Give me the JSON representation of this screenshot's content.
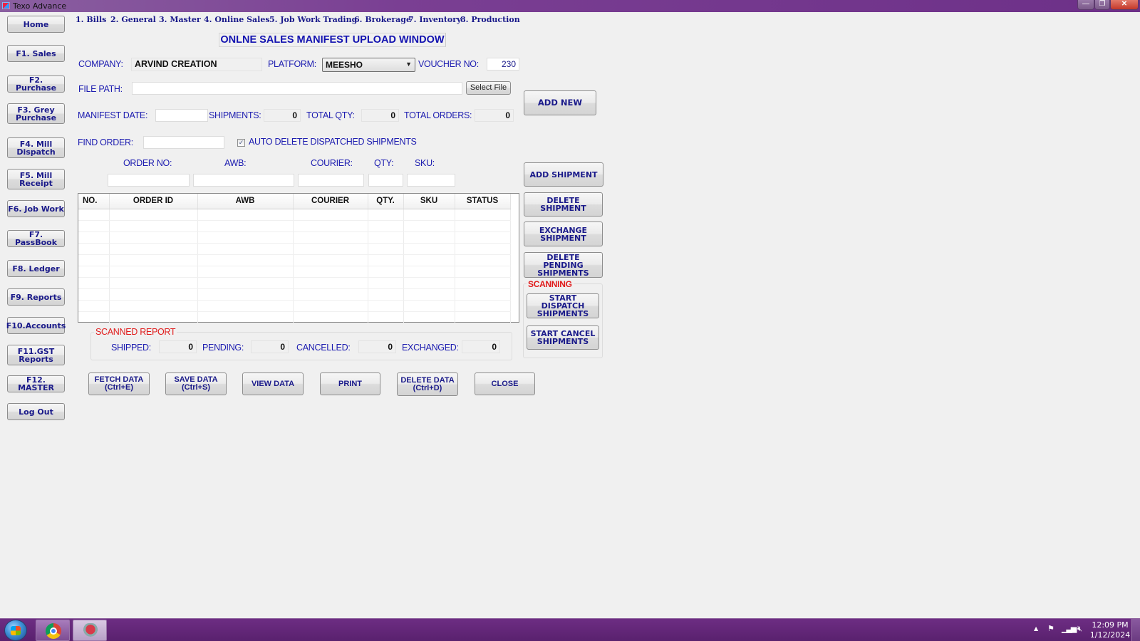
{
  "window": {
    "title": "Texo Advance",
    "controls": {
      "minimize": "—",
      "maximize": "❐",
      "close": "✕"
    }
  },
  "sidebar": {
    "items": [
      {
        "label": "Home"
      },
      {
        "label": "F1. Sales"
      },
      {
        "label": "F2. Purchase"
      },
      {
        "label": "F3. Grey Purchase"
      },
      {
        "label": "F4. Mill Dispatch"
      },
      {
        "label": "F5. Mill Receipt"
      },
      {
        "label": "F6. Job Work"
      },
      {
        "label": "F7. PassBook"
      },
      {
        "label": "F8. Ledger"
      },
      {
        "label": "F9. Reports"
      },
      {
        "label": "F10.Accounts"
      },
      {
        "label": "F11.GST Reports"
      },
      {
        "label": "F12. MASTER"
      },
      {
        "label": "Log Out"
      }
    ]
  },
  "menu": {
    "items": [
      {
        "label": "1. Bills"
      },
      {
        "label": "2. General"
      },
      {
        "label": "3. Master"
      },
      {
        "label": "4. Online Sales"
      },
      {
        "label": "5. Job Work Trading"
      },
      {
        "label": "6. Brokerage"
      },
      {
        "label": "7. Inventory"
      },
      {
        "label": "8. Production"
      }
    ]
  },
  "form": {
    "page_title": "ONLNE SALES MANIFEST UPLOAD WINDOW",
    "company_label": "COMPANY:",
    "company_value": "ARVIND CREATION",
    "platform_label": "PLATFORM:",
    "platform_value": "MEESHO",
    "voucher_label": "VOUCHER NO:",
    "voucher_value": "230",
    "file_path_label": "FILE PATH:",
    "file_path_value": "",
    "select_file_label": "Select File",
    "add_new_label": "ADD NEW",
    "manifest_date_label": "MANIFEST DATE:",
    "manifest_date_value": "",
    "shipments_label": "SHIPMENTS:",
    "shipments_value": "0",
    "total_qty_label": "TOTAL QTY:",
    "total_qty_value": "0",
    "total_orders_label": "TOTAL ORDERS:",
    "total_orders_value": "0",
    "find_order_label": "FIND ORDER:",
    "find_order_value": "",
    "auto_delete_label": "AUTO DELETE DISPATCHED SHIPMENTS",
    "auto_delete_checked": true,
    "check_glyph": "✓",
    "entry": {
      "order_no_label": "ORDER NO:",
      "awb_label": "AWB:",
      "courier_label": "COURIER:",
      "qty_label": "QTY:",
      "sku_label": "SKU:"
    }
  },
  "grid": {
    "columns": [
      "NO.",
      "ORDER ID",
      "AWB",
      "COURIER",
      "QTY.",
      "SKU",
      "STATUS"
    ],
    "rows": []
  },
  "actions": {
    "add_shipment": "ADD SHIPMENT",
    "delete_shipment": "DELETE SHIPMENT",
    "exchange_shipment": "EXCHANGE SHIPMENT",
    "delete_pending": "DELETE PENDING SHIPMENTS",
    "scanning_label": "SCANNING",
    "start_dispatch": "START DISPATCH SHIPMENTS",
    "start_cancel": "START CANCEL SHIPMENTS"
  },
  "scanned_report": {
    "title": "SCANNED REPORT",
    "shipped_label": "SHIPPED:",
    "shipped_value": "0",
    "pending_label": "PENDING:",
    "pending_value": "0",
    "cancelled_label": "CANCELLED:",
    "cancelled_value": "0",
    "exchanged_label": "EXCHANGED:",
    "exchanged_value": "0"
  },
  "bottom_buttons": {
    "fetch": "FETCH DATA (Ctrl+E)",
    "save": "SAVE DATA (Ctrl+S)",
    "view": "VIEW DATA",
    "print": "PRINT",
    "delete": "DELETE DATA (Ctrl+D)",
    "close": "CLOSE"
  },
  "taskbar": {
    "time": "12:09 PM",
    "date": "1/12/2024",
    "tray_arrow": "▲"
  },
  "colors": {
    "label_blue": "#1c1cb0",
    "accent_red": "#e01b1b",
    "taskbar_purple": "#6d2d83"
  }
}
